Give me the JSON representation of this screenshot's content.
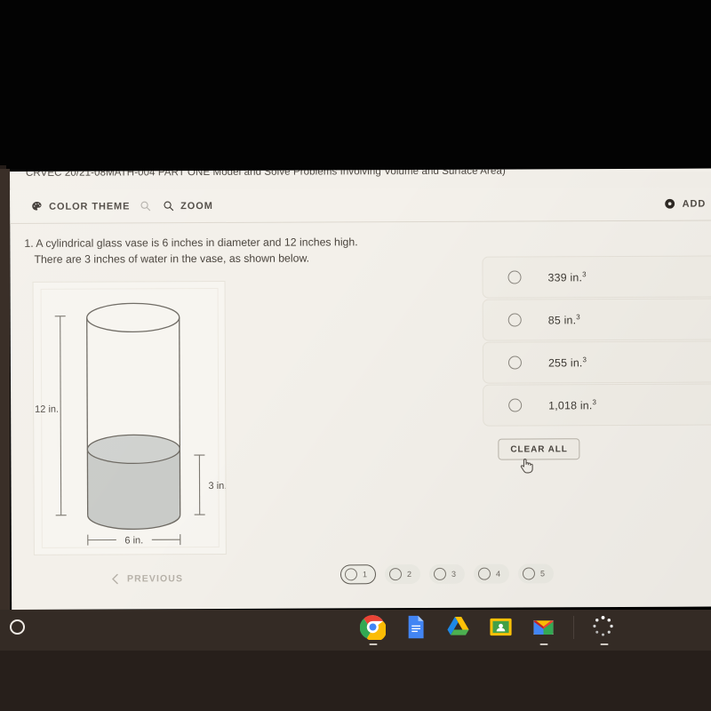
{
  "assignment": {
    "title": "CRVEC 20/21-08MATH-004 PART ONE Model and Solve Problems Involving Volume and Surface Area)"
  },
  "toolbar": {
    "color_theme_label": "COLOR THEME",
    "color_theme_icon": "palette-icon",
    "zoom_out_icon": "magnifier-faded-icon",
    "zoom_label": "ZOOM",
    "zoom_icon": "magnifier-icon",
    "add_label": "ADD",
    "add_icon": "circle-dot-icon"
  },
  "question": {
    "number": "1.",
    "line1": "A cylindrical glass vase is 6 inches in diameter and 12 inches high.",
    "line2": "There are 3 inches of water in the vase, as shown below."
  },
  "diagram": {
    "name": "cylinder-water-diagram",
    "height_label": "12 in.",
    "water_label": "3 in.",
    "diameter_label": "6 in.",
    "water_fill_color": "#c9cbc8",
    "outline_color": "#6e6a63"
  },
  "answers": {
    "options": [
      {
        "label": "339 in.",
        "exponent": "3",
        "selected": false
      },
      {
        "label": "85 in.",
        "exponent": "3",
        "selected": false
      },
      {
        "label": "255 in.",
        "exponent": "3",
        "selected": false
      },
      {
        "label": "1,018 in.",
        "exponent": "3",
        "selected": false
      }
    ],
    "clear_all_label": "CLEAR ALL"
  },
  "navigation": {
    "previous_label": "PREVIOUS",
    "previous_icon": "chevron-left-icon",
    "pages": [
      {
        "number": "1",
        "current": true
      },
      {
        "number": "2",
        "current": false
      },
      {
        "number": "3",
        "current": false
      },
      {
        "number": "4",
        "current": false
      },
      {
        "number": "5",
        "current": false
      }
    ]
  },
  "shelf": {
    "launcher_icon": "chromeos-launcher-icon",
    "apps": [
      {
        "name": "chrome-icon",
        "running": true
      },
      {
        "name": "google-docs-icon",
        "running": false
      },
      {
        "name": "google-drive-icon",
        "running": false
      },
      {
        "name": "google-classroom-icon",
        "running": false
      },
      {
        "name": "gmail-icon",
        "running": true
      },
      {
        "name": "loading-spinner-icon",
        "running": true
      }
    ]
  },
  "colors": {
    "page_background": "#f3f0ea",
    "text": "#4a443d",
    "shelf": "#342b25",
    "bezel": "#3a2f28"
  }
}
